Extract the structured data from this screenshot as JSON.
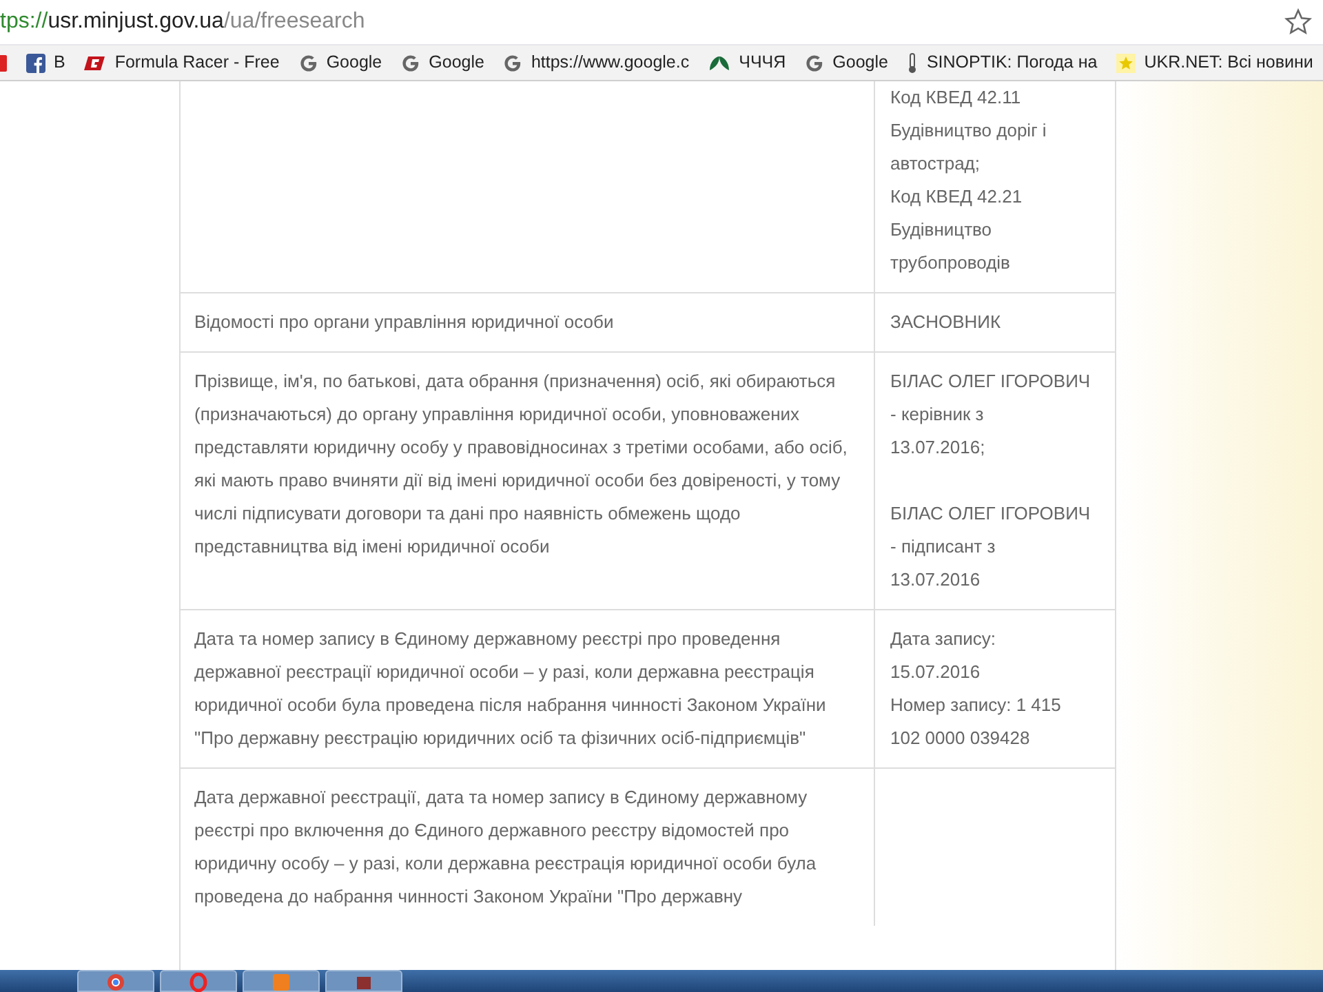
{
  "address_bar": {
    "scheme": "tps://",
    "host": "usr.minjust.gov.ua",
    "path": "/ua/freesearch"
  },
  "bookmarks": [
    {
      "kind": "plain"
    },
    {
      "kind": "facebook",
      "label": "B"
    },
    {
      "kind": "racer",
      "label": "Formula Racer - Free"
    },
    {
      "kind": "google",
      "label": "Google"
    },
    {
      "kind": "google",
      "label": "Google"
    },
    {
      "kind": "google",
      "label": "https://www.google.c"
    },
    {
      "kind": "leaf",
      "label": "ЧЧЧЯ"
    },
    {
      "kind": "google",
      "label": "Google"
    },
    {
      "kind": "thermo",
      "label": "SINOPTIK: Погода на"
    },
    {
      "kind": "ukr",
      "label": "UKR.NET: Всі новини"
    }
  ],
  "table": {
    "rows": [
      {
        "groups": [
          [
            "Код КВЕД 42.11",
            "Будівництво доріг і",
            "автострад;",
            "Код КВЕД 42.21",
            "Будівництво",
            "трубопроводів"
          ]
        ]
      },
      {
        "field": "Відомості про органи управління юридичної особи",
        "groups": [
          [
            "ЗАСНОВНИК"
          ]
        ]
      },
      {
        "field": "Прізвище, ім'я, по батькові, дата обрання (призначення) осіб, які обираються (призначаються) до органу управління юридичної особи, уповноважених представляти юридичну особу у правовідносинах з третіми особами, або осіб, які мають право вчиняти дії від імені юридичної особи без довіреності, у тому числі підписувати договори та дані про наявність обмежень щодо представництва від імені юридичної особи",
        "groups": [
          [
            "БІЛАС ОЛЕГ ІГОРОВИЧ",
            "- керівник з",
            "13.07.2016;"
          ],
          [
            "БІЛАС ОЛЕГ ІГОРОВИЧ",
            "- підписант з",
            "13.07.2016"
          ]
        ]
      },
      {
        "field": "Дата та номер запису в Єдиному державному реєстрі про проведення державної реєстрації юридичної особи – у разі, коли державна реєстрація юридичної особи була проведена після набрання чинності Законом України \"Про державну реєстрацію юридичних осіб та фізичних осіб-підприємців\"",
        "groups": [
          [
            "Дата запису:",
            "15.07.2016",
            "Номер запису: 1 415",
            "102 0000 039428"
          ]
        ]
      },
      {
        "field": "Дата державної реєстрації, дата та номер запису в Єдиному державному реєстрі про включення до Єдиного державного реєстру відомостей про юридичну особу – у разі, коли державна реєстрація юридичної особи була проведена до набрання чинності Законом України \"Про державну"
      }
    ]
  },
  "taskbar": {
    "apps": [
      {
        "kind": "chrome"
      },
      {
        "kind": "opera"
      },
      {
        "kind": "tile"
      },
      {
        "kind": "book"
      }
    ]
  }
}
